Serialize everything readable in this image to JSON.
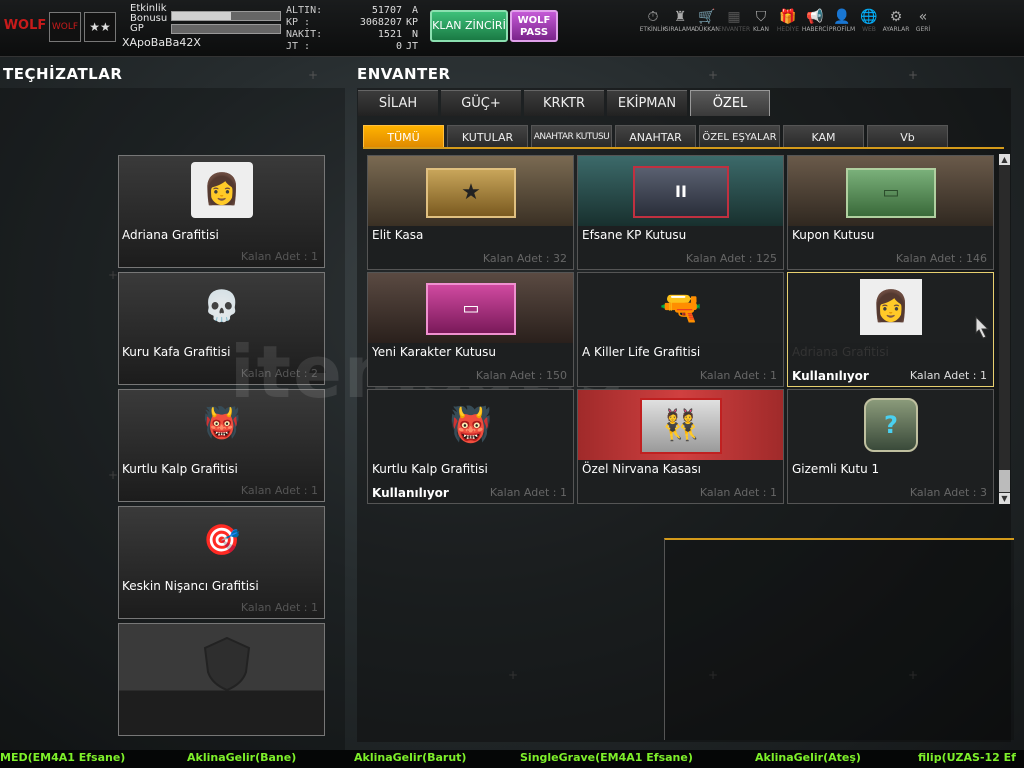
{
  "topbar": {
    "logo": "WOLF",
    "rank1": "WOLF",
    "rank2": "★★",
    "event_bonus_label": "Etkinlik Bonusu",
    "event_bonus_progress": 0.55,
    "gp_label": "GP",
    "gp_progress": 0.0,
    "nickname": "XApoBaBa42X",
    "stats": [
      {
        "key": "ALTIN:",
        "value": "51707",
        "unit": "A"
      },
      {
        "key": "KP  :",
        "value": "3068207",
        "unit": "KP"
      },
      {
        "key": "NAKİT:",
        "value": "1521",
        "unit": "N"
      },
      {
        "key": "JT  :",
        "value": "0",
        "unit": "JT"
      }
    ],
    "klan_button": "KLAN ZİNCİRİ",
    "wolf_button": "WOLF PASS",
    "nav": [
      {
        "label": "ETKİNLİK",
        "icon": "⏱"
      },
      {
        "label": "SIRALAMA",
        "icon": "♜"
      },
      {
        "label": "DÜKKAN",
        "icon": "🛒"
      },
      {
        "label": "ENVANTER",
        "icon": "▦"
      },
      {
        "label": "KLAN",
        "icon": "⛉"
      },
      {
        "label": "HEDİYE",
        "icon": "🎁"
      },
      {
        "label": "HABERCİ",
        "icon": "📢"
      },
      {
        "label": "PROFİLM",
        "icon": "👤"
      },
      {
        "label": "WEB",
        "icon": "🌐"
      },
      {
        "label": "AYARLAR",
        "icon": "⚙"
      },
      {
        "label": "GERİ",
        "icon": "«"
      }
    ]
  },
  "left": {
    "title": "TEÇHİZATLAR",
    "items": [
      {
        "name": "Adriana Grafitisi",
        "count": "Kalan Adet : 1",
        "icon": "👩"
      },
      {
        "name": "Kuru Kafa Grafitisi",
        "count": "Kalan Adet : 2",
        "icon": "💀"
      },
      {
        "name": "Kurtlu Kalp Grafitisi",
        "count": "Kalan Adet : 1",
        "icon": "👹"
      },
      {
        "name": "Keskin Nişancı Grafitisi",
        "count": "Kalan Adet : 1",
        "icon": "🎯"
      }
    ]
  },
  "inventory": {
    "title": "ENVANTER",
    "tabs": [
      "SİLAH",
      "GÜÇ+",
      "KRKTR",
      "EKİPMAN",
      "ÖZEL"
    ],
    "subtabs": [
      "TÜMÜ",
      "KUTULAR",
      "ANAHTAR KUTUSU",
      "ANAHTAR",
      "ÖZEL EŞYALAR",
      "KAM",
      "Vb"
    ],
    "items": [
      {
        "name": "Elit Kasa",
        "count": "Kalan Adet : 32",
        "status": "",
        "icon": "★"
      },
      {
        "name": "Efsane KP Kutusu",
        "count": "Kalan Adet : 125",
        "status": "",
        "icon": "II"
      },
      {
        "name": "Kupon Kutusu",
        "count": "Kalan Adet : 146",
        "status": "",
        "icon": "▭"
      },
      {
        "name": "Yeni Karakter Kutusu",
        "count": "Kalan Adet : 150",
        "status": "",
        "icon": "▭"
      },
      {
        "name": "A Killer Life Grafitisi",
        "count": "Kalan Adet : 1",
        "status": "",
        "icon": "🔫"
      },
      {
        "name": "Adriana Grafitisi",
        "count": "Kalan Adet : 1",
        "status": "Kullanılıyor",
        "icon": "👩"
      },
      {
        "name": "Kurtlu Kalp Grafitisi",
        "count": "Kalan Adet : 1",
        "status": "Kullanılıyor",
        "icon": "👹"
      },
      {
        "name": "Özel Nirvana Kasası",
        "count": "Kalan Adet : 1",
        "status": "",
        "icon": "👯"
      },
      {
        "name": "Gizemli Kutu 1",
        "count": "Kalan Adet : 3",
        "status": "",
        "icon": "?"
      }
    ]
  },
  "ticker": [
    "MED(EM4A1 Efsane)",
    "AklinaGelir(Bane)",
    "AklinaGelir(Barut)",
    "SingleGrave(EM4A1 Efsane)",
    "AklinaGelir(Ateş)",
    "filip(UZAS-12 Ef"
  ],
  "watermark": "itemsatis",
  "colors": {
    "accent": "#e08a00",
    "ticker": "#7ef02a",
    "klan": "#1a7a44",
    "wolf": "#7a238a"
  }
}
